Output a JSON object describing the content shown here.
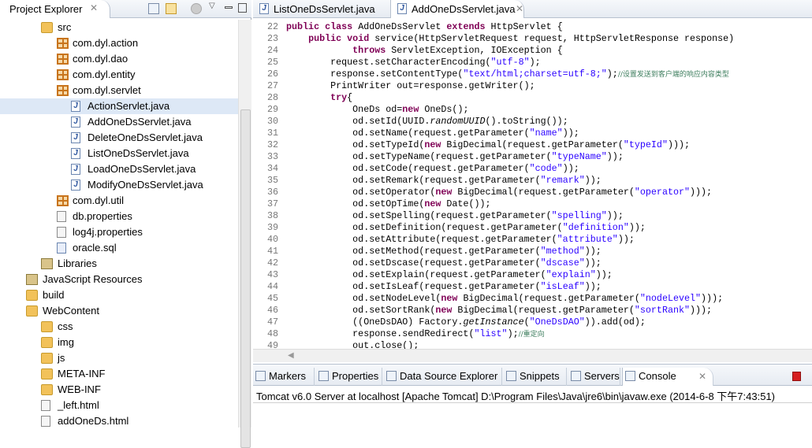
{
  "project_explorer": {
    "title": "Project Explorer",
    "items": [
      {
        "label": "src",
        "icon": "source-folder-icon"
      },
      {
        "label": "com.dyl.action",
        "icon": "package-icon"
      },
      {
        "label": "com.dyl.dao",
        "icon": "package-warning-icon"
      },
      {
        "label": "com.dyl.entity",
        "icon": "package-icon"
      },
      {
        "label": "com.dyl.servlet",
        "icon": "package-warning-icon"
      },
      {
        "label": "ActionServlet.java",
        "icon": "java-file-icon"
      },
      {
        "label": "AddOneDsServlet.java",
        "icon": "java-file-icon"
      },
      {
        "label": "DeleteOneDsServlet.java",
        "icon": "java-file-icon"
      },
      {
        "label": "ListOneDsServlet.java",
        "icon": "java-file-icon"
      },
      {
        "label": "LoadOneDsServlet.java",
        "icon": "java-file-icon"
      },
      {
        "label": "ModifyOneDsServlet.java",
        "icon": "java-file-icon"
      },
      {
        "label": "com.dyl.util",
        "icon": "package-icon"
      },
      {
        "label": "db.properties",
        "icon": "properties-file-icon"
      },
      {
        "label": "log4j.properties",
        "icon": "properties-file-icon"
      },
      {
        "label": "oracle.sql",
        "icon": "sql-file-icon"
      },
      {
        "label": "Libraries",
        "icon": "libraries-icon"
      },
      {
        "label": "JavaScript Resources",
        "icon": "javascript-resources-icon"
      },
      {
        "label": "build",
        "icon": "folder-icon"
      },
      {
        "label": "WebContent",
        "icon": "folder-open-icon"
      },
      {
        "label": "css",
        "icon": "folder-icon"
      },
      {
        "label": "img",
        "icon": "folder-icon"
      },
      {
        "label": "js",
        "icon": "folder-icon"
      },
      {
        "label": "META-INF",
        "icon": "folder-icon"
      },
      {
        "label": "WEB-INF",
        "icon": "folder-icon"
      },
      {
        "label": "_left.html",
        "icon": "html-file-icon"
      },
      {
        "label": "addOneDs.html",
        "icon": "html-file-icon"
      }
    ]
  },
  "editor": {
    "tabs": [
      {
        "label": "ListOneDsServlet.java"
      },
      {
        "label": "AddOneDsServlet.java",
        "active": true
      }
    ],
    "lines": [
      {
        "n": "22",
        "seg": [
          [
            "k",
            "public"
          ],
          [
            "p",
            " "
          ],
          [
            "k",
            "class"
          ],
          [
            "p",
            " AddOneDsServlet "
          ],
          [
            "k",
            "extends"
          ],
          [
            "p",
            " HttpServlet {"
          ]
        ]
      },
      {
        "n": "23",
        "seg": [
          [
            "p",
            "    "
          ],
          [
            "k",
            "public"
          ],
          [
            "p",
            " "
          ],
          [
            "k",
            "void"
          ],
          [
            "p",
            " service(HttpServletRequest request, HttpServletResponse response)"
          ]
        ]
      },
      {
        "n": "24",
        "seg": [
          [
            "p",
            "            "
          ],
          [
            "k",
            "throws"
          ],
          [
            "p",
            " ServletException, IOException {"
          ]
        ]
      },
      {
        "n": "25",
        "seg": [
          [
            "p",
            "        request.setCharacterEncoding("
          ],
          [
            "s",
            "\"utf-8\""
          ],
          [
            "p",
            ");"
          ]
        ]
      },
      {
        "n": "26",
        "seg": [
          [
            "p",
            "        response.setContentType("
          ],
          [
            "s",
            "\"text/html;charset=utf-8;\""
          ],
          [
            "p",
            ");"
          ],
          [
            "c",
            "//设置发送到客户端的响应内容类型"
          ]
        ]
      },
      {
        "n": "27",
        "seg": [
          [
            "p",
            "        PrintWriter out=response.getWriter();"
          ]
        ]
      },
      {
        "n": "28",
        "seg": [
          [
            "p",
            "        "
          ],
          [
            "k",
            "try"
          ],
          [
            "p",
            "{"
          ]
        ]
      },
      {
        "n": "29",
        "seg": [
          [
            "p",
            "            OneDs od="
          ],
          [
            "k",
            "new"
          ],
          [
            "p",
            " OneDs();"
          ]
        ]
      },
      {
        "n": "30",
        "seg": [
          [
            "p",
            "            od.setId(UUID."
          ],
          [
            "i",
            "randomUUID"
          ],
          [
            "p",
            "().toString());"
          ]
        ]
      },
      {
        "n": "31",
        "seg": [
          [
            "p",
            "            od.setName(request.getParameter("
          ],
          [
            "s",
            "\"name\""
          ],
          [
            "p",
            "));"
          ]
        ]
      },
      {
        "n": "32",
        "seg": [
          [
            "p",
            "            od.setTypeId("
          ],
          [
            "k",
            "new"
          ],
          [
            "p",
            " BigDecimal(request.getParameter("
          ],
          [
            "s",
            "\"typeId\""
          ],
          [
            "p",
            ")));"
          ]
        ]
      },
      {
        "n": "33",
        "seg": [
          [
            "p",
            "            od.setTypeName(request.getParameter("
          ],
          [
            "s",
            "\"typeName\""
          ],
          [
            "p",
            "));"
          ]
        ]
      },
      {
        "n": "34",
        "seg": [
          [
            "p",
            "            od.setCode(request.getParameter("
          ],
          [
            "s",
            "\"code\""
          ],
          [
            "p",
            "));"
          ]
        ]
      },
      {
        "n": "35",
        "seg": [
          [
            "p",
            "            od.setRemark(request.getParameter("
          ],
          [
            "s",
            "\"remark\""
          ],
          [
            "p",
            "));"
          ]
        ]
      },
      {
        "n": "36",
        "seg": [
          [
            "p",
            "            od.setOperator("
          ],
          [
            "k",
            "new"
          ],
          [
            "p",
            " BigDecimal(request.getParameter("
          ],
          [
            "s",
            "\"operator\""
          ],
          [
            "p",
            ")));"
          ]
        ]
      },
      {
        "n": "37",
        "seg": [
          [
            "p",
            "            od.setOpTime("
          ],
          [
            "k",
            "new"
          ],
          [
            "p",
            " Date());"
          ]
        ]
      },
      {
        "n": "38",
        "seg": [
          [
            "p",
            "            od.setSpelling(request.getParameter("
          ],
          [
            "s",
            "\"spelling\""
          ],
          [
            "p",
            "));"
          ]
        ]
      },
      {
        "n": "39",
        "seg": [
          [
            "p",
            "            od.setDefinition(request.getParameter("
          ],
          [
            "s",
            "\"definition\""
          ],
          [
            "p",
            "));"
          ]
        ]
      },
      {
        "n": "40",
        "seg": [
          [
            "p",
            "            od.setAttribute(request.getParameter("
          ],
          [
            "s",
            "\"attribute\""
          ],
          [
            "p",
            "));"
          ]
        ]
      },
      {
        "n": "41",
        "seg": [
          [
            "p",
            "            od.setMethod(request.getParameter("
          ],
          [
            "s",
            "\"method\""
          ],
          [
            "p",
            "));"
          ]
        ]
      },
      {
        "n": "42",
        "seg": [
          [
            "p",
            "            od.setDscase(request.getParameter("
          ],
          [
            "s",
            "\"dscase\""
          ],
          [
            "p",
            "));"
          ]
        ]
      },
      {
        "n": "43",
        "seg": [
          [
            "p",
            "            od.setExplain(request.getParameter("
          ],
          [
            "s",
            "\"explain\""
          ],
          [
            "p",
            "));"
          ]
        ]
      },
      {
        "n": "44",
        "seg": [
          [
            "p",
            "            od.setIsLeaf(request.getParameter("
          ],
          [
            "s",
            "\"isLeaf\""
          ],
          [
            "p",
            "));"
          ]
        ]
      },
      {
        "n": "45",
        "seg": [
          [
            "p",
            "            od.setNodeLevel("
          ],
          [
            "k",
            "new"
          ],
          [
            "p",
            " BigDecimal(request.getParameter("
          ],
          [
            "s",
            "\"nodeLevel\""
          ],
          [
            "p",
            ")));"
          ]
        ]
      },
      {
        "n": "46",
        "seg": [
          [
            "p",
            "            od.setSortRank("
          ],
          [
            "k",
            "new"
          ],
          [
            "p",
            " BigDecimal(request.getParameter("
          ],
          [
            "s",
            "\"sortRank\""
          ],
          [
            "p",
            ")));"
          ]
        ]
      },
      {
        "n": "47",
        "seg": [
          [
            "p",
            "            ((OneDsDAO) Factory."
          ],
          [
            "i",
            "getInstance"
          ],
          [
            "p",
            "("
          ],
          [
            "s",
            "\"OneDsDAO\""
          ],
          [
            "p",
            ")).add(od);"
          ]
        ]
      },
      {
        "n": "48",
        "seg": [
          [
            "p",
            "            response.sendRedirect("
          ],
          [
            "s",
            "\"list\""
          ],
          [
            "p",
            ");"
          ],
          [
            "c",
            "//重定向"
          ]
        ]
      },
      {
        "n": "49",
        "seg": [
          [
            "p",
            "            out.close();"
          ]
        ]
      }
    ]
  },
  "bottom": {
    "tabs": [
      {
        "label": "Markers"
      },
      {
        "label": "Properties"
      },
      {
        "label": "Data Source Explorer"
      },
      {
        "label": "Snippets"
      },
      {
        "label": "Servers"
      },
      {
        "label": "Console",
        "active": true
      }
    ],
    "console_header": "Tomcat v6.0 Server at localhost [Apache Tomcat] D:\\Program Files\\Java\\jre6\\bin\\javaw.exe (2014-6-8 下午7:43:51)"
  },
  "colors": {
    "keyword": "#7f0055",
    "string": "#2a00ff",
    "comment": "#3f7f5f"
  }
}
